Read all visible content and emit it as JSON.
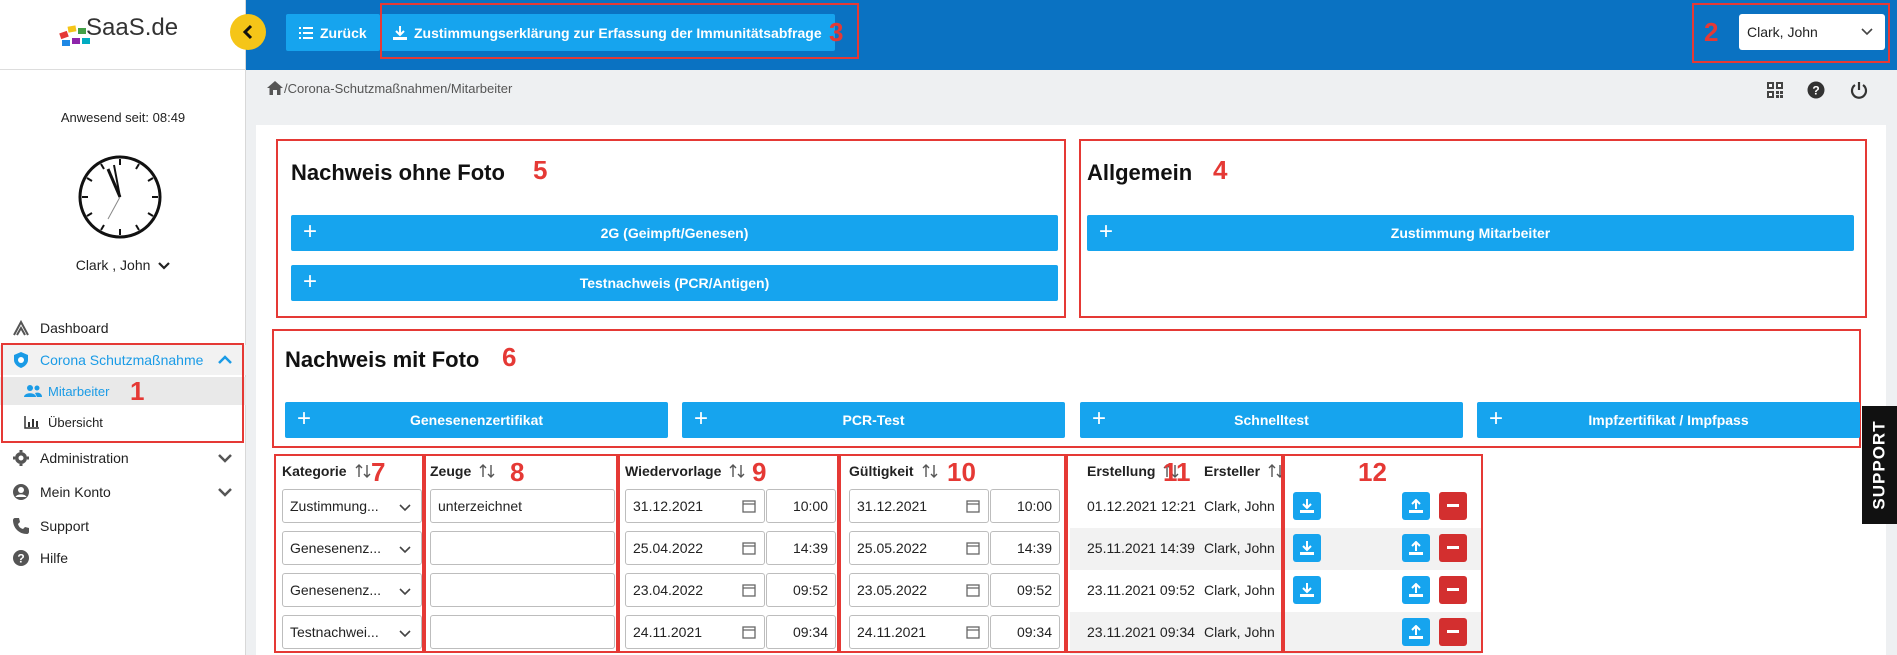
{
  "brand": {
    "logo_text": "SaaS.de"
  },
  "sidebar": {
    "present_label": "Anwesend seit: 08:49",
    "user_name": "Clark , John",
    "items": [
      {
        "label": "Dashboard"
      },
      {
        "label": "Corona Schutzmaßnahme"
      },
      {
        "label": "Mitarbeiter"
      },
      {
        "label": "Übersicht"
      },
      {
        "label": "Administration"
      },
      {
        "label": "Mein Konto"
      },
      {
        "label": "Support"
      },
      {
        "label": "Hilfe"
      }
    ]
  },
  "topbar": {
    "back_label": "Zurück",
    "download_label": "Zustimmungserklärung zur Erfassung der Immunitätsabfrage",
    "user_select_value": "Clark, John"
  },
  "breadcrumb": "/Corona-Schutzmaßnahmen/Mitarbeiter",
  "annotations": [
    "1",
    "2",
    "3",
    "4",
    "5",
    "6",
    "7",
    "8",
    "9",
    "10",
    "11",
    "12"
  ],
  "sections": {
    "ohne_foto": {
      "title": "Nachweis ohne Foto",
      "buttons": [
        "2G (Geimpft/Genesen)",
        "Testnachweis (PCR/Antigen)"
      ]
    },
    "allgemein": {
      "title": "Allgemein",
      "buttons": [
        "Zustimmung Mitarbeiter"
      ]
    },
    "mit_foto": {
      "title": "Nachweis mit Foto",
      "buttons": [
        "Genesenenzertifikat",
        "PCR-Test",
        "Schnelltest",
        "Impfzertifikat / Impfpass"
      ]
    }
  },
  "table": {
    "headers": {
      "kategorie": "Kategorie",
      "zeuge": "Zeuge",
      "wiedervorlage": "Wiedervorlage",
      "gueltigkeit": "Gültigkeit",
      "erstellung": "Erstellung",
      "ersteller": "Ersteller"
    },
    "rows": [
      {
        "kategorie": "Zustimmung...",
        "zeuge": "unterzeichnet",
        "wv_date": "31.12.2021",
        "wv_time": "10:00",
        "gu_date": "31.12.2021",
        "gu_time": "10:00",
        "erstellung": "01.12.2021 12:21",
        "ersteller": "Clark, John"
      },
      {
        "kategorie": "Genesenenz...",
        "zeuge": "",
        "wv_date": "25.04.2022",
        "wv_time": "14:39",
        "gu_date": "25.05.2022",
        "gu_time": "14:39",
        "erstellung": "25.11.2021 14:39",
        "ersteller": "Clark, John"
      },
      {
        "kategorie": "Genesenenz...",
        "zeuge": "",
        "wv_date": "23.04.2022",
        "wv_time": "09:52",
        "gu_date": "23.05.2022",
        "gu_time": "09:52",
        "erstellung": "23.11.2021 09:52",
        "ersteller": "Clark, John"
      },
      {
        "kategorie": "Testnachwei...",
        "zeuge": "",
        "wv_date": "24.11.2021",
        "wv_time": "09:34",
        "gu_date": "24.11.2021",
        "gu_time": "09:34",
        "erstellung": "23.11.2021 09:34",
        "ersteller": "Clark, John"
      }
    ]
  },
  "support_tab": "SUPPORT",
  "colors": {
    "topbar": "#0a72c2",
    "button": "#16a4ee",
    "accent_red": "#e53935",
    "delete": "#d32f2f",
    "collapse": "#f5c518"
  }
}
